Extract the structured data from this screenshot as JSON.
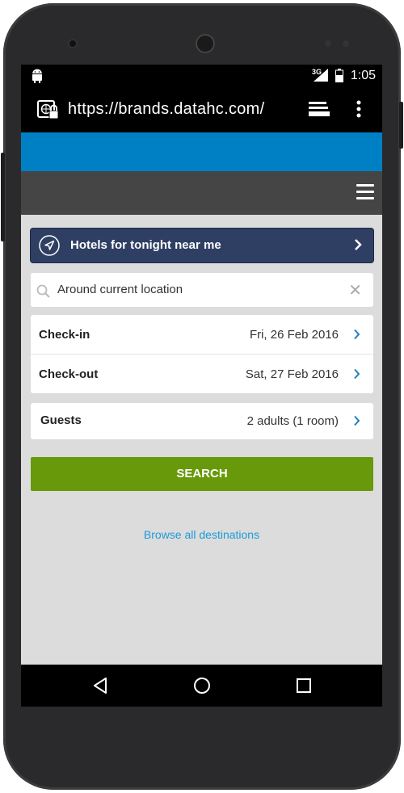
{
  "status_bar": {
    "network": "3G",
    "time": "1:05"
  },
  "browser": {
    "url": "https://brands.datahc.com/"
  },
  "page": {
    "near_me_label": "Hotels for tonight near me",
    "search_value": "Around current location",
    "checkin_label": "Check-in",
    "checkin_value": "Fri, 26 Feb 2016",
    "checkout_label": "Check-out",
    "checkout_value": "Sat, 27 Feb 2016",
    "guests_label": "Guests",
    "guests_value": "2 adults (1 room)",
    "search_button": "SEARCH",
    "browse_link": "Browse all destinations",
    "clear_symbol": "✕"
  },
  "colors": {
    "brand_blue": "#0080c4",
    "header_dark": "#454545",
    "near_me_navy": "#2f3f64",
    "search_green": "#67990a",
    "link_blue": "#1a9bd7",
    "chevron_blue": "#1a7fc0"
  },
  "icons": [
    "android-icon",
    "signal-icon",
    "battery-icon",
    "site-lock-icon",
    "tabs-icon",
    "overflow-menu-icon",
    "hamburger-icon",
    "navigation-icon",
    "chevron-right-icon",
    "search-icon",
    "close-icon",
    "back-icon",
    "home-icon",
    "recents-icon"
  ]
}
